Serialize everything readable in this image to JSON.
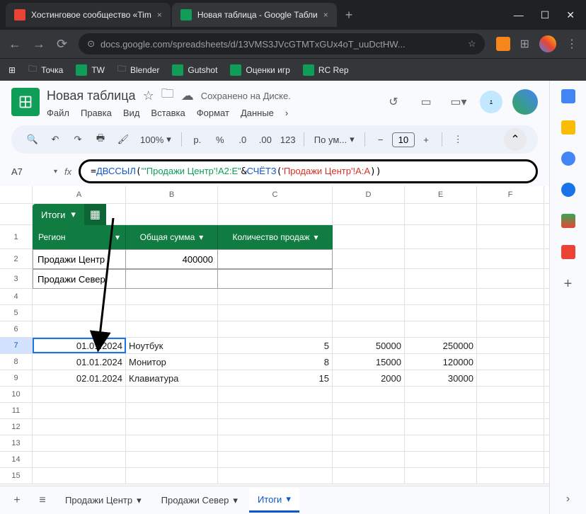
{
  "browser": {
    "tabs": [
      {
        "title": "Хостинговое сообщество «Tim",
        "icon_color": "#ea4335"
      },
      {
        "title": "Новая таблица - Google Табли",
        "icon_color": "#0f9d58"
      }
    ],
    "url": "docs.google.com/spreadsheets/d/13VMS3JVcGTMTxGUx4oT_uuDctHW...",
    "bookmarks": [
      {
        "label": "Точка",
        "type": "folder"
      },
      {
        "label": "TW",
        "type": "sheets"
      },
      {
        "label": "Blender",
        "type": "folder"
      },
      {
        "label": "Gutshot",
        "type": "sheets"
      },
      {
        "label": "Оценки игр",
        "type": "sheets"
      },
      {
        "label": "RC Rep",
        "type": "sheets"
      }
    ]
  },
  "doc": {
    "title": "Новая таблица",
    "saved_text": "Сохранено на Диске.",
    "menu": [
      "Файл",
      "Правка",
      "Вид",
      "Вставка",
      "Формат",
      "Данные"
    ]
  },
  "toolbar": {
    "zoom": "100%",
    "currency": "р.",
    "font_default": "По ум...",
    "font_size": "10"
  },
  "formula": {
    "cell_ref": "A7",
    "raw": "=ДВССЫЛ(\"'Продажи Центр'!A2:E\"&СЧЁТЗ('Продажи Центр'!A:A))"
  },
  "extract": {
    "title": "Итоги",
    "cols": [
      "Регион",
      "Общая сумма",
      "Количество продаж"
    ],
    "rows": [
      {
        "region": "Продажи Центр",
        "sum": "400000",
        "count": ""
      },
      {
        "region": "Продажи Север",
        "sum": "",
        "count": ""
      }
    ]
  },
  "grid": {
    "columns": [
      "A",
      "B",
      "C",
      "D",
      "E",
      "F"
    ],
    "data_rows": [
      {
        "n": 7,
        "A": "01.01.2024",
        "B": "Ноутбук",
        "C": "5",
        "D": "50000",
        "E": "250000"
      },
      {
        "n": 8,
        "A": "01.01.2024",
        "B": "Монитор",
        "C": "8",
        "D": "15000",
        "E": "120000"
      },
      {
        "n": 9,
        "A": "02.01.2024",
        "B": "Клавиатура",
        "C": "15",
        "D": "2000",
        "E": "30000"
      }
    ]
  },
  "sheets": {
    "tabs": [
      "Продажи Центр",
      "Продажи Север",
      "Итоги"
    ],
    "active": 2
  }
}
